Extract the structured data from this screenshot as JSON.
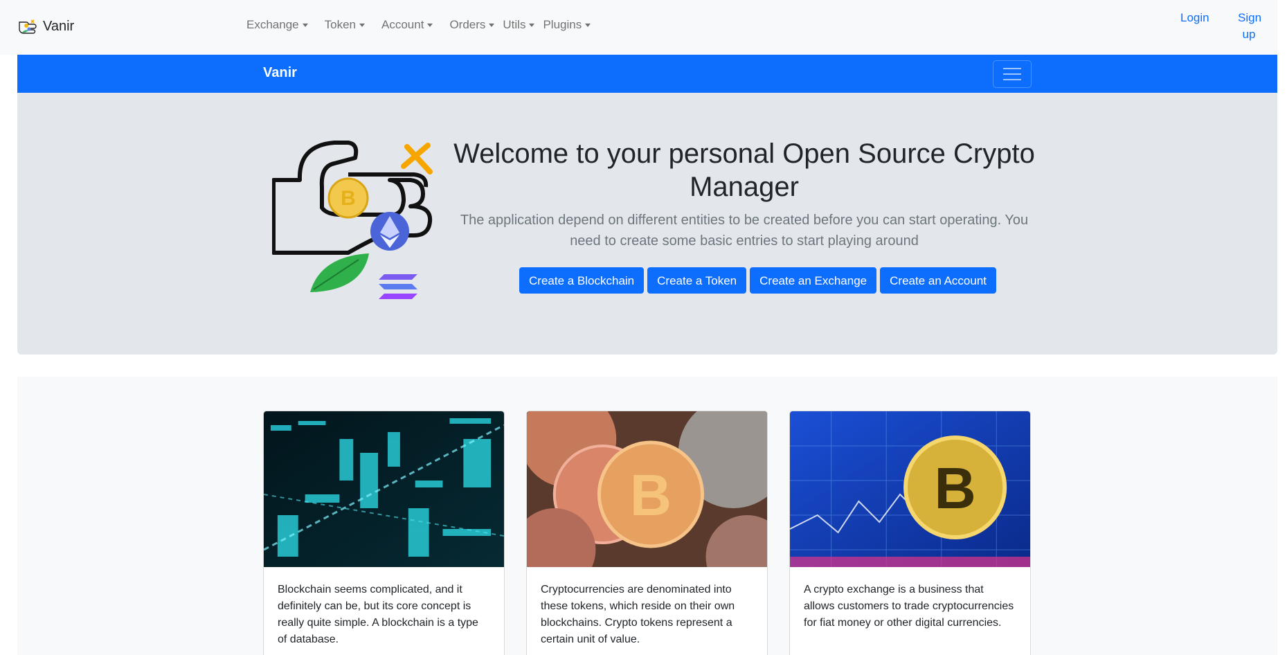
{
  "brand": {
    "name": "Vanir",
    "logo_icon": "vanir-logo-icon"
  },
  "nav": {
    "items": [
      {
        "label": "Exchange"
      },
      {
        "label": "Token"
      },
      {
        "label": "Account"
      },
      {
        "label": "Orders"
      },
      {
        "label": "Utils"
      },
      {
        "label": "Plugins"
      }
    ],
    "login": "Login",
    "signup_line1": "Sign",
    "signup_line2": "up"
  },
  "bluebar": {
    "title": "Vanir",
    "toggler_icon": "hamburger-menu-icon"
  },
  "hero": {
    "title": "Welcome to your personal Open Source Crypto Manager",
    "lead": "The application depend on different entities to be created before you can start operating. You need to create some basic entries to start playing around",
    "buttons": [
      {
        "label": "Create a Blockchain"
      },
      {
        "label": "Create a Token"
      },
      {
        "label": "Create an Exchange"
      },
      {
        "label": "Create an Account"
      }
    ]
  },
  "cards": [
    {
      "text": "Blockchain seems complicated, and it definitely can be, but its core concept is really quite simple. A blockchain is a type of database."
    },
    {
      "text": "Cryptocurrencies are denominated into these tokens, which reside on their own blockchains. Crypto tokens represent a certain unit of value."
    },
    {
      "text": "A crypto exchange is a business that allows customers to trade cryptocurrencies for fiat money or other digital currencies."
    }
  ],
  "colors": {
    "primary": "#0d6efd",
    "hero_bg": "#e3e7eb",
    "nav_bg": "#f8f9fa"
  }
}
